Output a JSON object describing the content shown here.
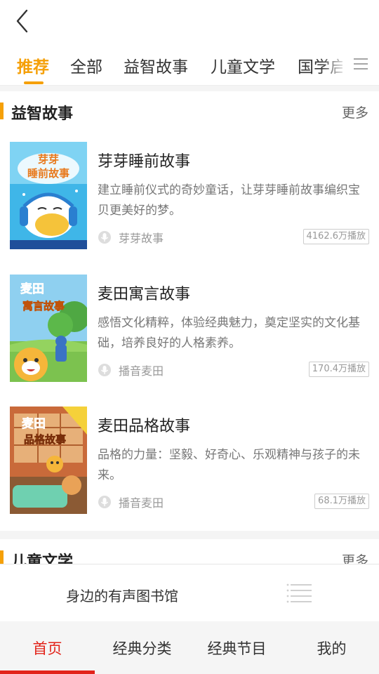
{
  "header": {
    "back_icon": "chevron-left-icon"
  },
  "tabs": {
    "items": [
      "推荐",
      "全部",
      "益智故事",
      "儿童文学",
      "国学启"
    ],
    "active_index": 0,
    "menu_icon": "hamburger-menu-icon"
  },
  "section1": {
    "title": "益智故事",
    "more": "更多",
    "books": [
      {
        "title": "芽芽睡前故事",
        "desc": "建立睡前仪式的奇妙童话，让芽芽睡前故事编织宝贝更美好的梦。",
        "author": "芽芽故事",
        "plays": "4162.6万播放",
        "cover_text": "芽芽睡前故事"
      },
      {
        "title": "麦田寓言故事",
        "desc": "感悟文化精粹，体验经典魅力，奠定坚实的文化基础，培养良好的人格素养。",
        "author": "播音麦田",
        "plays": "170.4万播放",
        "cover_text": "麦田寓言故事"
      },
      {
        "title": "麦田品格故事",
        "desc": "品格的力量：坚毅、好奇心、乐观精神与孩子的未来。",
        "author": "播音麦田",
        "plays": "68.1万播放",
        "cover_text": "麦田品格故事"
      }
    ]
  },
  "section2": {
    "title": "儿童文学",
    "more": "更多"
  },
  "player": {
    "text": "身边的有声图书馆",
    "icon": "playlist-icon"
  },
  "bottom_nav": {
    "items": [
      "首页",
      "经典分类",
      "经典节目",
      "我的"
    ],
    "active_index": 0
  },
  "colors": {
    "accent": "#f5a008",
    "nav_active": "#e2231a",
    "text_gray": "#777777"
  }
}
